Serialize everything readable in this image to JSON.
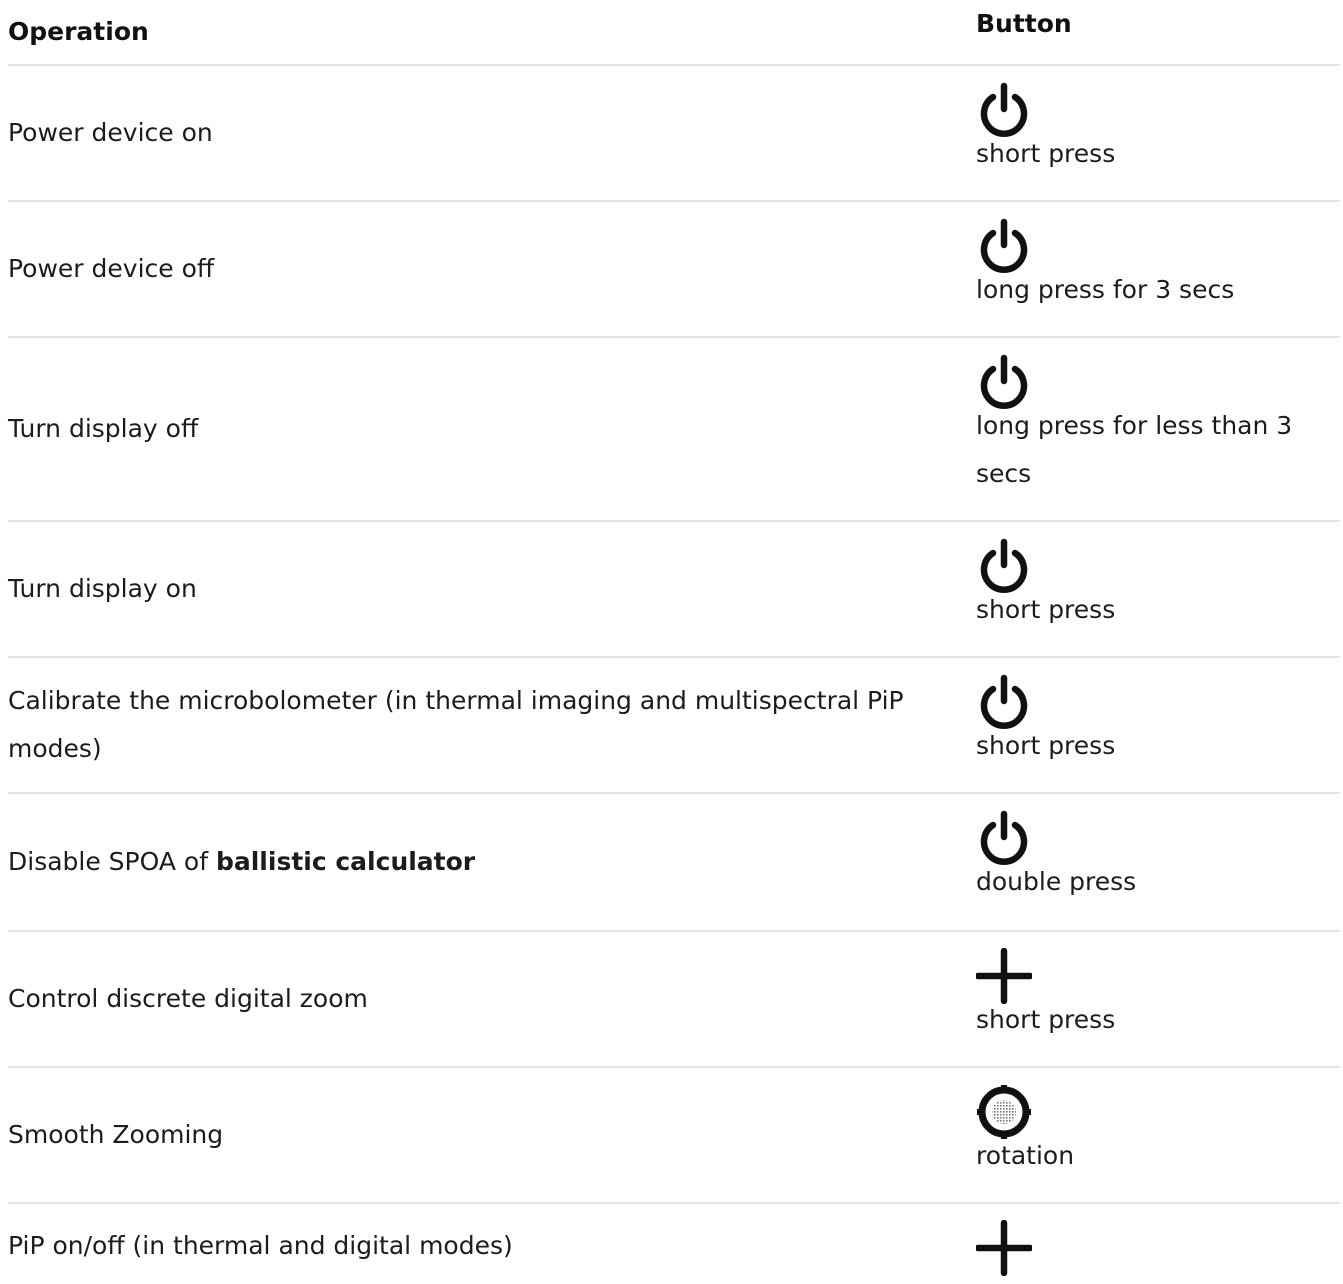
{
  "header": {
    "operation": "Operation",
    "button": "Button"
  },
  "rows": [
    {
      "operation": "Power device on",
      "operation_bold": "",
      "icon": "power-icon",
      "action": "short press"
    },
    {
      "operation": "Power device off",
      "operation_bold": "",
      "icon": "power-icon",
      "action": "long press for 3 secs"
    },
    {
      "operation": "Turn display off",
      "operation_bold": "",
      "icon": "power-icon",
      "action": "long press for less than 3 secs"
    },
    {
      "operation": "Turn display on",
      "operation_bold": "",
      "icon": "power-icon",
      "action": "short press"
    },
    {
      "operation": "Calibrate the microbolometer (in thermal imaging and multispectral PiP modes)",
      "operation_bold": "",
      "icon": "power-icon",
      "action": "short press"
    },
    {
      "operation": "Disable SPOA of ",
      "operation_bold": "ballistic calculator",
      "icon": "power-icon",
      "action": "double press"
    },
    {
      "operation": "Control discrete digital zoom",
      "operation_bold": "",
      "icon": "plus-icon",
      "action": "short press"
    },
    {
      "operation": "Smooth Zooming",
      "operation_bold": "",
      "icon": "rotary-dial-icon",
      "action": "rotation"
    },
    {
      "operation": "PiP on/off (in thermal and digital modes)",
      "operation_bold": "",
      "icon": "plus-icon",
      "action": ""
    }
  ]
}
